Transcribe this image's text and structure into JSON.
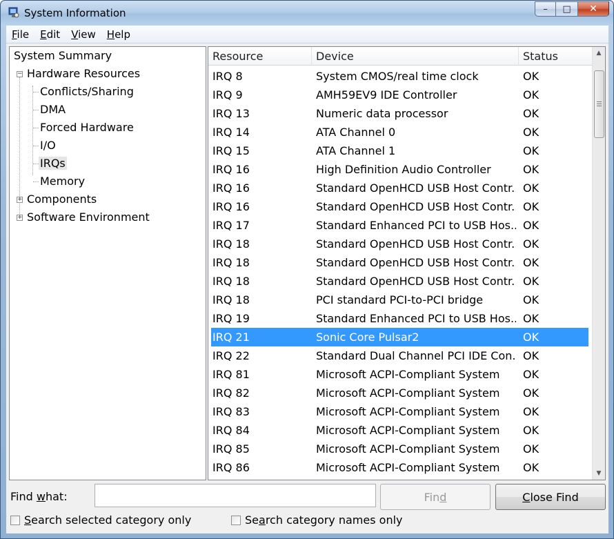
{
  "window": {
    "title": "System Information",
    "controls": {
      "minimize": "–",
      "maximize": "□",
      "close": "✕"
    }
  },
  "menu": [
    {
      "label": "File",
      "accel": "F",
      "rest": "ile"
    },
    {
      "label": "Edit",
      "accel": "E",
      "rest": "dit"
    },
    {
      "label": "View",
      "accel": "V",
      "rest": "iew"
    },
    {
      "label": "Help",
      "accel": "H",
      "rest": "elp"
    }
  ],
  "tree": {
    "root": "System Summary",
    "hardware": "Hardware Resources",
    "hardware_children": [
      "Conflicts/Sharing",
      "DMA",
      "Forced Hardware",
      "I/O",
      "IRQs",
      "Memory"
    ],
    "selected": "IRQs",
    "components": "Components",
    "software": "Software Environment"
  },
  "list": {
    "columns": [
      "Resource",
      "Device",
      "Status"
    ],
    "rows": [
      {
        "resource": "IRQ 8",
        "device": "System CMOS/real time clock",
        "status": "OK"
      },
      {
        "resource": "IRQ 9",
        "device": "AMH59EV9 IDE Controller",
        "status": "OK"
      },
      {
        "resource": "IRQ 13",
        "device": "Numeric data processor",
        "status": "OK"
      },
      {
        "resource": "IRQ 14",
        "device": "ATA Channel 0",
        "status": "OK"
      },
      {
        "resource": "IRQ 15",
        "device": "ATA Channel 1",
        "status": "OK"
      },
      {
        "resource": "IRQ 16",
        "device": "High Definition Audio Controller",
        "status": "OK"
      },
      {
        "resource": "IRQ 16",
        "device": "Standard OpenHCD USB Host Contr...",
        "status": "OK"
      },
      {
        "resource": "IRQ 16",
        "device": "Standard OpenHCD USB Host Contr...",
        "status": "OK"
      },
      {
        "resource": "IRQ 17",
        "device": "Standard Enhanced PCI to USB Hos...",
        "status": "OK"
      },
      {
        "resource": "IRQ 18",
        "device": "Standard OpenHCD USB Host Contr...",
        "status": "OK"
      },
      {
        "resource": "IRQ 18",
        "device": "Standard OpenHCD USB Host Contr...",
        "status": "OK"
      },
      {
        "resource": "IRQ 18",
        "device": "Standard OpenHCD USB Host Contr...",
        "status": "OK"
      },
      {
        "resource": "IRQ 18",
        "device": "PCI standard PCI-to-PCI bridge",
        "status": "OK"
      },
      {
        "resource": "IRQ 19",
        "device": "Standard Enhanced PCI to USB Hos...",
        "status": "OK"
      },
      {
        "resource": "IRQ 21",
        "device": "Sonic Core Pulsar2",
        "status": "OK"
      },
      {
        "resource": "IRQ 22",
        "device": "Standard Dual Channel PCI IDE Con...",
        "status": "OK"
      },
      {
        "resource": "IRQ 81",
        "device": "Microsoft ACPI-Compliant System",
        "status": "OK"
      },
      {
        "resource": "IRQ 82",
        "device": "Microsoft ACPI-Compliant System",
        "status": "OK"
      },
      {
        "resource": "IRQ 83",
        "device": "Microsoft ACPI-Compliant System",
        "status": "OK"
      },
      {
        "resource": "IRQ 84",
        "device": "Microsoft ACPI-Compliant System",
        "status": "OK"
      },
      {
        "resource": "IRQ 85",
        "device": "Microsoft ACPI-Compliant System",
        "status": "OK"
      },
      {
        "resource": "IRQ 86",
        "device": "Microsoft ACPI-Compliant System",
        "status": "OK"
      }
    ],
    "selected_index": 14,
    "selection_color": "#3399ff"
  },
  "find": {
    "label_pre": "Find ",
    "label_accel": "w",
    "label_post": "hat:",
    "value": "",
    "find_pre": "Fin",
    "find_accel": "d",
    "close_accel": "C",
    "close_post": "lose Find",
    "check1_pre": "",
    "check1_accel": "S",
    "check1_post": "earch selected category only",
    "check2_pre": "Se",
    "check2_accel": "a",
    "check2_post": "rch category names only"
  }
}
